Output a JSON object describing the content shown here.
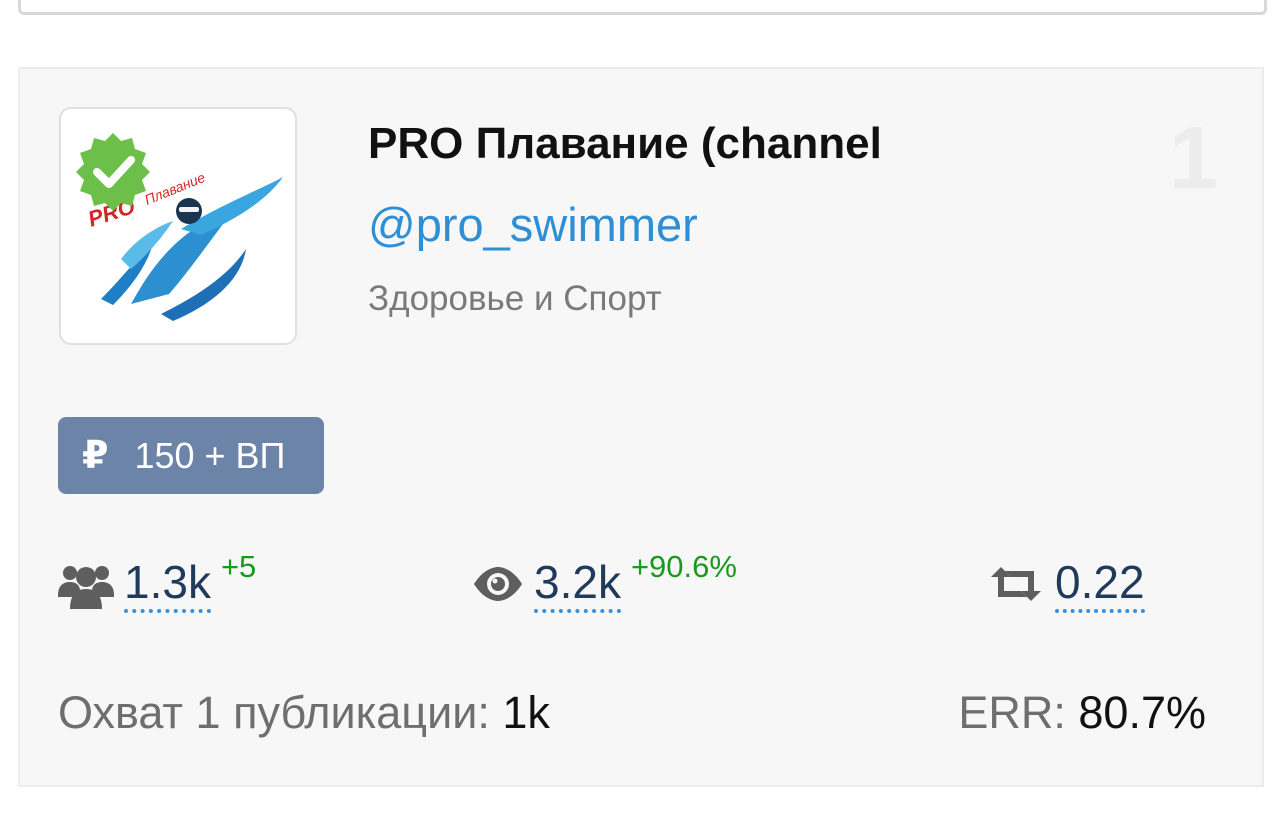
{
  "channel": {
    "title": "PRO Плавание (channel",
    "handle": "@pro_swimmer",
    "category": "Здоровье и Спорт",
    "rank": "1",
    "verified": true,
    "logo_text": "PRO Плавание"
  },
  "price": {
    "currency_icon": "ruble-icon",
    "currency_symbol": "₽",
    "label": "150 + ВП"
  },
  "stats": {
    "subscribers": {
      "icon": "users-icon",
      "value": "1.3k",
      "delta": "+5"
    },
    "views": {
      "icon": "eye-icon",
      "value": "3.2k",
      "delta": "+90.6%"
    },
    "reposts": {
      "icon": "retweet-icon",
      "value": "0.22"
    }
  },
  "reach": {
    "label": "Охват 1 публикации:",
    "value": "1k"
  },
  "err": {
    "label": "ERR:",
    "value": "80.7%"
  },
  "colors": {
    "accent_link": "#2f8fd6",
    "price_badge": "#6d84a9",
    "delta_green": "#1a9a1a",
    "verified_green": "#6cc04a"
  }
}
